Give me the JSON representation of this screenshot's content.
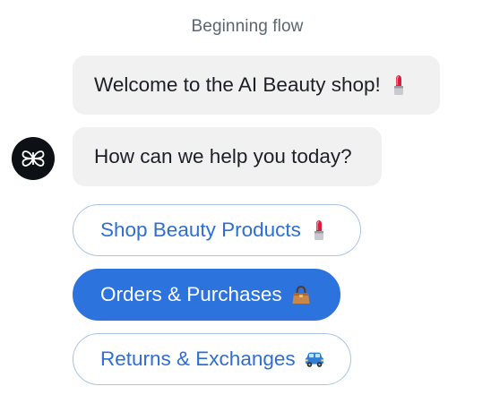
{
  "flow": {
    "header": "Beginning flow"
  },
  "bot": {
    "avatar_icon": "butterfly-logo-icon"
  },
  "messages": [
    {
      "text": "Welcome to the AI Beauty shop!",
      "icon": "lipstick-icon"
    },
    {
      "text": "How can we help you today?"
    }
  ],
  "options": [
    {
      "label": "Shop Beauty Products",
      "icon": "lipstick-icon",
      "selected": false
    },
    {
      "label": "Orders & Purchases",
      "icon": "handbag-icon",
      "selected": true
    },
    {
      "label": "Returns & Exchanges",
      "icon": "car-icon",
      "selected": false
    }
  ],
  "colors": {
    "accent": "#2d73de",
    "outline": "#a9c4e7",
    "bubble": "#f1f1f2",
    "avatar": "#0d1014"
  }
}
